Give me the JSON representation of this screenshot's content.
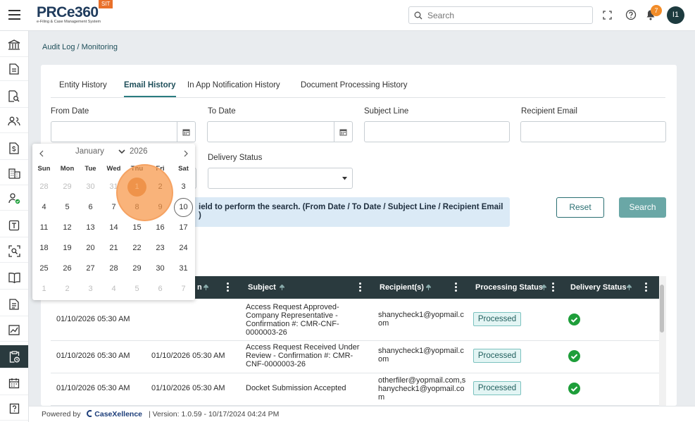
{
  "header": {
    "brand": "PRCe360",
    "brand_sub": "e-Filing & Case Management System",
    "env_badge": "SIT",
    "search_placeholder": "Search",
    "notifications_count": "7",
    "avatar_initials": "I1",
    "icons": [
      "menu-icon",
      "fullscreen-icon",
      "help-icon",
      "bell-icon"
    ]
  },
  "breadcrumb": "Audit Log / Monitoring",
  "tabs": [
    {
      "label": "Entity History",
      "active": false
    },
    {
      "label": "Email History",
      "active": true
    },
    {
      "label": "In App Notification History",
      "active": false
    },
    {
      "label": "Document Processing History",
      "active": false
    }
  ],
  "filters": {
    "from_date_label": "From Date",
    "to_date_label": "To Date",
    "subject_label": "Subject Line",
    "recipient_label": "Recipient Email",
    "delivery_status_label": "Delivery Status",
    "from_date_value": "",
    "to_date_value": "",
    "subject_value": "",
    "recipient_value": ""
  },
  "info_text": "ield to perform the search. (From Date / To Date / Subject Line / Recipient Email",
  "info_text_2": ")",
  "buttons": {
    "reset": "Reset",
    "search": "Search"
  },
  "table": {
    "headers": [
      "n",
      "Subject",
      "Recipient(s)",
      "Processing Status",
      "Delivery Status"
    ],
    "rows": [
      {
        "created": "01/10/2026 05:30 AM",
        "sent": "",
        "subject": "Access Request Approved-Company Representative - Confirmation #: CMR-CNF-0000003-26",
        "recipients": "shanycheck1@yopmail.com",
        "status": "Processed"
      },
      {
        "created": "01/10/2026 05:30 AM",
        "sent": "01/10/2026 05:30 AM",
        "subject": "Access Request Received Under Review - Confirmation #: CMR-CNF-0000003-26",
        "recipients": "shanycheck1@yopmail.com",
        "status": "Processed"
      },
      {
        "created": "01/10/2026 05:30 AM",
        "sent": "01/10/2026 05:30 AM",
        "subject": "Docket Submission Accepted",
        "recipients": "otherfiler@yopmail.com,shanycheck1@yopmail.com",
        "status": "Processed"
      }
    ]
  },
  "datepicker": {
    "month": "January",
    "year": "2026",
    "weekdays": [
      "Sun",
      "Mon",
      "Tue",
      "Wed",
      "Thu",
      "Fri",
      "Sat"
    ],
    "weeks": [
      [
        "28",
        "29",
        "30",
        "31",
        "1",
        "2",
        "3"
      ],
      [
        "4",
        "5",
        "6",
        "7",
        "8",
        "9",
        "10"
      ],
      [
        "11",
        "12",
        "13",
        "14",
        "15",
        "16",
        "17"
      ],
      [
        "18",
        "19",
        "20",
        "21",
        "22",
        "23",
        "24"
      ],
      [
        "25",
        "26",
        "27",
        "28",
        "29",
        "30",
        "31"
      ],
      [
        "1",
        "2",
        "3",
        "4",
        "5",
        "6",
        "7"
      ]
    ],
    "today": "10",
    "selected": "1"
  },
  "footer": {
    "powered_by": "Powered by",
    "company": "CaseXellence",
    "version": "| Version: 1.0.59 - 10/17/2024 04:24 PM"
  },
  "colors": {
    "accent": "#2a7c80",
    "header_dark": "#2a3a3e",
    "badge": "#f28c28",
    "highlight": "#f79646",
    "success": "#1e9e3a"
  }
}
